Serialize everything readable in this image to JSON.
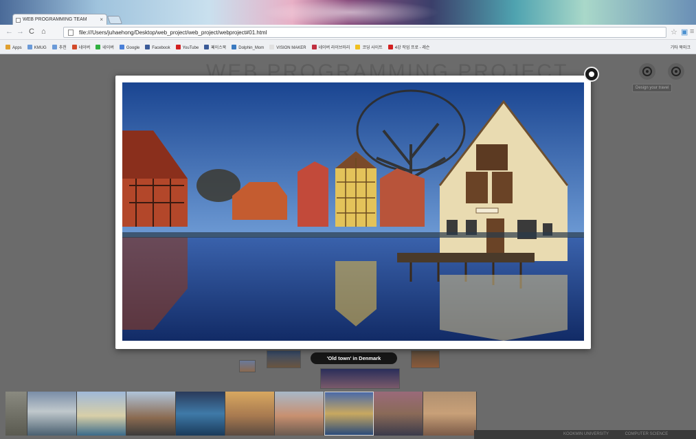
{
  "browser": {
    "tab_title": "WEB PROGRAMMING TEAM",
    "tab_close": "×",
    "url": "file:///Users/juhaehong/Desktop/web_project/web_project/webproject#01.html",
    "bookmarks": [
      {
        "label": "Apps",
        "color": "#e0a030"
      },
      {
        "label": "KMUG",
        "color": "#6a9ad8"
      },
      {
        "label": "추천",
        "color": "#6a9ad8"
      },
      {
        "label": "네이버",
        "color": "#d24a2a"
      },
      {
        "label": "네이버",
        "color": "#30b040"
      },
      {
        "label": "Google",
        "color": "#4a80d8"
      },
      {
        "label": "Facebook",
        "color": "#3b5b98"
      },
      {
        "label": "YouTube",
        "color": "#d22020"
      },
      {
        "label": "페이스북",
        "color": "#3b5b98"
      },
      {
        "label": "Dolphin_Mom",
        "color": "#3a7ac0"
      },
      {
        "label": "VISION MAKER",
        "color": "#e0e0e0"
      },
      {
        "label": "네이버 라이브러리",
        "color": "#c03040"
      },
      {
        "label": "코딩 사이트",
        "color": "#f0c020"
      },
      {
        "label": "4강 작업 프로 - 레슨",
        "color": "#d22020"
      }
    ],
    "other_bookmarks": "기타 북마크"
  },
  "page": {
    "title": "WEB PROGRAMMING PROJECT",
    "design_tip": "Design your travel",
    "caption": "'Old town' in Denmark",
    "footer_left": "KOOKMIN UNIVERSITY",
    "footer_right": "COMPUTER SCIENCE"
  },
  "colors": {
    "sky": "#1f4f9c",
    "water": "#1c3f86",
    "red_house": "#b3472a",
    "yellow_house": "#e3c35a",
    "cream_house": "#e9dbb1"
  }
}
